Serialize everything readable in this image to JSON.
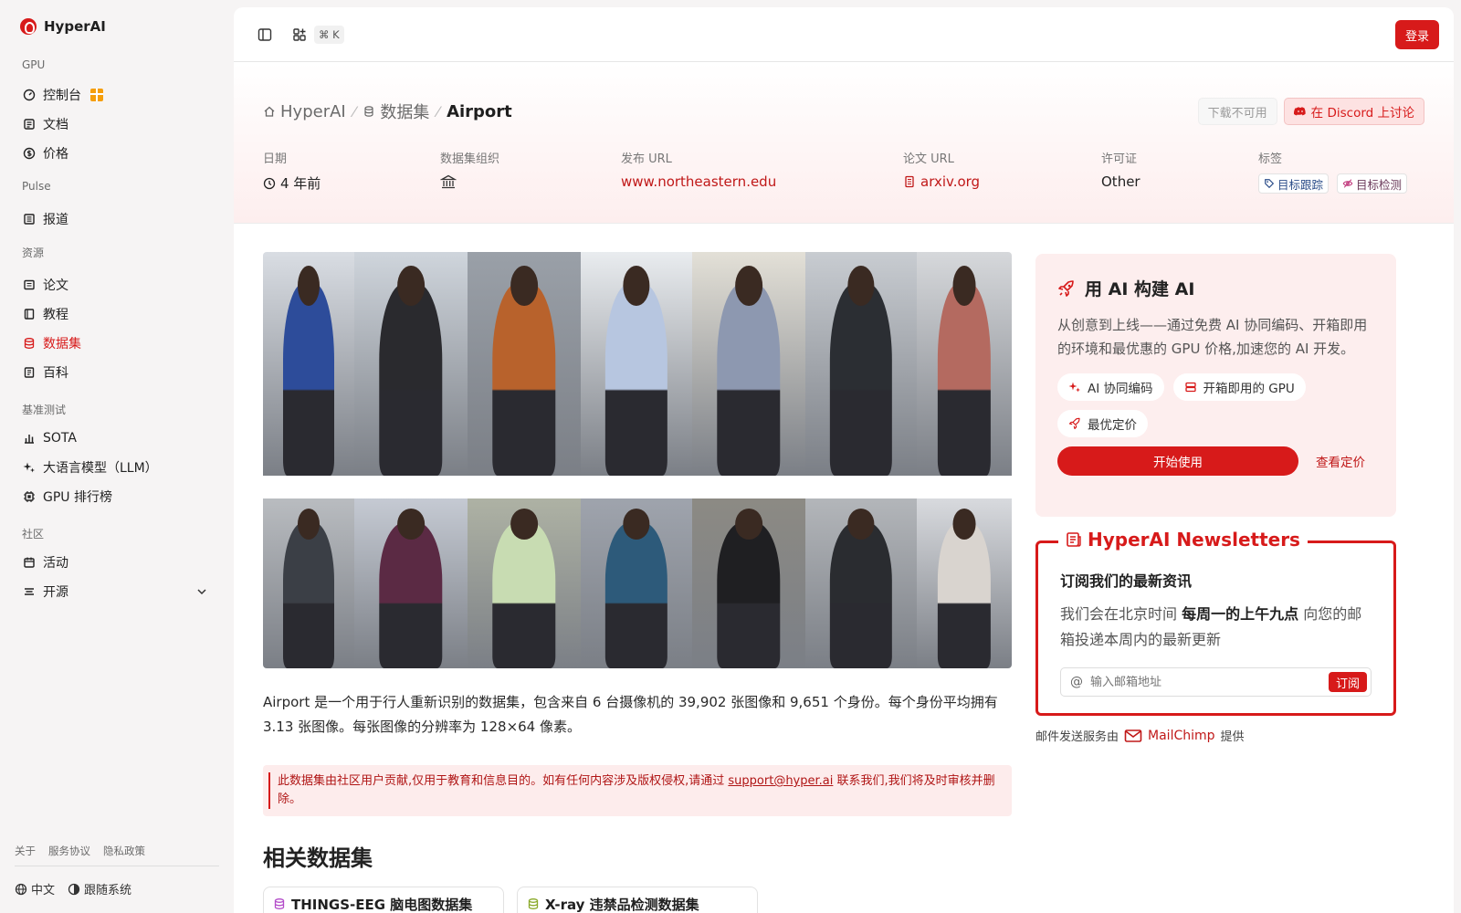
{
  "brand": {
    "name": "HyperAI"
  },
  "sidebar": {
    "sections": [
      {
        "title": "GPU",
        "items": [
          {
            "label": "控制台",
            "icon": "gauge-icon"
          },
          {
            "label": "文档",
            "icon": "doc-icon"
          },
          {
            "label": "价格",
            "icon": "dollar-icon"
          }
        ]
      },
      {
        "title": "Pulse",
        "items": [
          {
            "label": "报道",
            "icon": "newspaper-icon"
          }
        ]
      },
      {
        "title": "资源",
        "items": [
          {
            "label": "论文",
            "icon": "paper-icon"
          },
          {
            "label": "教程",
            "icon": "book-icon"
          },
          {
            "label": "数据集",
            "icon": "database-icon",
            "active": true
          },
          {
            "label": "百科",
            "icon": "wiki-icon"
          }
        ]
      },
      {
        "title": "基准测试",
        "items": [
          {
            "label": "SOTA",
            "icon": "chart-icon"
          },
          {
            "label": "大语言模型（LLM）",
            "icon": "sparkle-icon"
          },
          {
            "label": "GPU 排行榜",
            "icon": "chip-icon"
          }
        ]
      },
      {
        "title": "社区",
        "items": [
          {
            "label": "活动",
            "icon": "calendar-icon"
          },
          {
            "label": "开源",
            "icon": "list-icon"
          }
        ]
      }
    ],
    "footer_links": [
      "关于",
      "服务协议",
      "隐私政策"
    ],
    "language": "中文",
    "theme": "跟随系统"
  },
  "topbar": {
    "shortcut": "⌘ K",
    "login": "登录"
  },
  "breadcrumb": {
    "home": "HyperAI",
    "section": "数据集",
    "current": "Airport"
  },
  "actions": {
    "download": "下载不可用",
    "discord": "在 Discord 上讨论"
  },
  "meta": {
    "date_label": "日期",
    "date_value": "4 年前",
    "org_label": "数据集组织",
    "publish_label": "发布 URL",
    "publish_value": "www.northeastern.edu",
    "paper_label": "论文 URL",
    "paper_value": "arxiv.org",
    "license_label": "许可证",
    "license_value": "Other",
    "tags_label": "标签",
    "tags": [
      "目标跟踪",
      "目标检测"
    ]
  },
  "description": "Airport 是一个用于行人重新识别的数据集，包含来自 6 台摄像机的 39,902 张图像和 9,651 个身份。每个身份平均拥有 3.13 张图像。每张图像的分辨率为 128×64 像素。",
  "notice": {
    "before": "此数据集由社区用户贡献,仅用于教育和信息目的。如有任何内容涉及版权侵权,请通过 ",
    "email": "support@hyper.ai",
    "after": " 联系我们,我们将及时审核并删除。"
  },
  "related": {
    "title": "相关数据集",
    "items": [
      "THINGS-EEG 脑电图数据集",
      "X-ray 违禁品检测数据集"
    ]
  },
  "promo": {
    "title": "用 AI 构建 AI",
    "desc": "从创意到上线——通过免费 AI 协同编码、开箱即用的环境和最优惠的 GPU 价格,加速您的 AI 开发。",
    "chips": [
      "AI 协同编码",
      "开箱即用的 GPU",
      "最优定价"
    ],
    "start": "开始使用",
    "pricing": "查看定价"
  },
  "newsletter": {
    "legend": "HyperAI Newsletters",
    "heading": "订阅我们的最新资讯",
    "desc_before": "我们会在北京时间 ",
    "desc_bold": "每周一的上午九点",
    "desc_after": " 向您的邮箱投递本周内的最新更新",
    "placeholder": "输入邮箱地址",
    "submit": "订阅",
    "by_before": "邮件发送服务由",
    "by_brand": "MailChimp",
    "by_after": "提供"
  },
  "colors": {
    "accent": "#d71a1a",
    "accent_soft": "#fdeeee"
  }
}
